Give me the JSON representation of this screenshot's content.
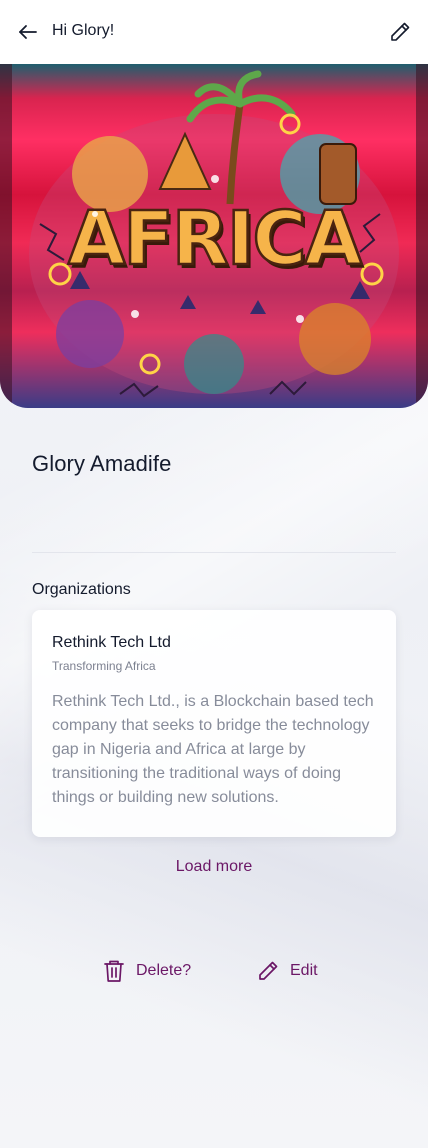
{
  "header": {
    "title": "Hi Glory!",
    "back_icon": "arrow-left-icon",
    "edit_icon": "pencil-icon"
  },
  "banner": {
    "image_text": "AFRICA",
    "description": "colorful doodle artwork"
  },
  "profile": {
    "name": "Glory Amadife"
  },
  "organizations": {
    "section_label": "Organizations",
    "items": [
      {
        "name": "Rethink Tech Ltd",
        "tagline": "Transforming Africa",
        "description": "Rethink Tech Ltd., is a Blockchain based tech company that seeks to bridge the technology gap in Nigeria and Africa at large by transitioning the traditional ways of doing things or building new solutions."
      }
    ],
    "load_more_label": "Load more"
  },
  "actions": {
    "delete_label": "Delete?",
    "edit_label": "Edit",
    "delete_icon": "trash-icon",
    "edit_icon": "pencil-icon"
  },
  "colors": {
    "accent": "#6b1766",
    "text_primary": "#141b2d",
    "text_muted": "#878c9a"
  }
}
